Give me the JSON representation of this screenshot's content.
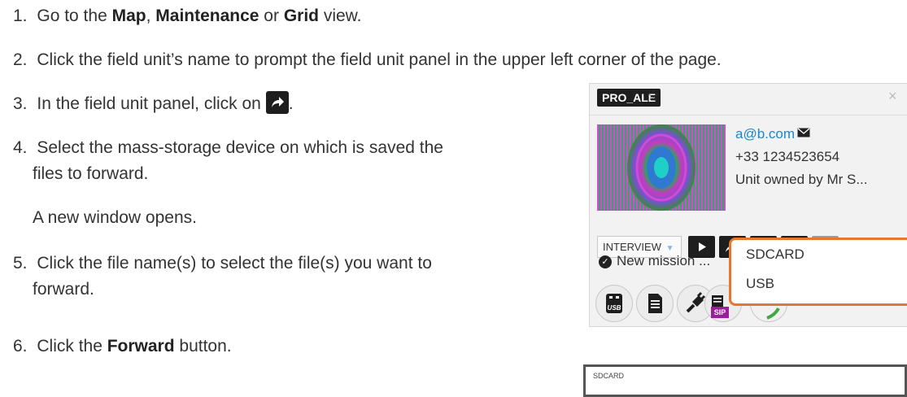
{
  "steps": [
    {
      "num": "1.",
      "pre": "Go to the ",
      "b1": "Map",
      "mid1": ", ",
      "b2": "Maintenance",
      "mid2": " or ",
      "b3": "Grid",
      "post": " view."
    },
    {
      "num": "2.",
      "text": "Click the field unit’s name to prompt the field unit panel in the upper left corner of the page."
    },
    {
      "num": "3.",
      "text": "In the field unit panel, click on",
      "post": "."
    },
    {
      "num": "4.",
      "line1": "Select the mass-storage device on which is saved the",
      "line2": "files to forward."
    },
    {
      "note": "A new window opens."
    },
    {
      "num": "5.",
      "line1": "Click the file name(s) to select the file(s) you want to",
      "line2": "forward."
    },
    {
      "num": "6.",
      "pre": "Click the ",
      "bold": "Forward",
      "post": " button."
    }
  ],
  "panel": {
    "unit_name": "PRO_ALE",
    "star": "☆",
    "close": "×",
    "email": "a@b.com",
    "phone": "+33 1234523654",
    "owner": "Unit owned by Mr S...",
    "mode": "INTERVIEW",
    "mission": "New mission ...",
    "sip_badge": "SIP",
    "usb_badge": "USB",
    "dropdown": [
      "SDCARD",
      "USB"
    ]
  },
  "window": {
    "title": "SDCARD"
  },
  "colors": {
    "accent_orange": "#e8772e",
    "link_blue": "#1a88c9",
    "sip_purple": "#9a1f9a"
  }
}
